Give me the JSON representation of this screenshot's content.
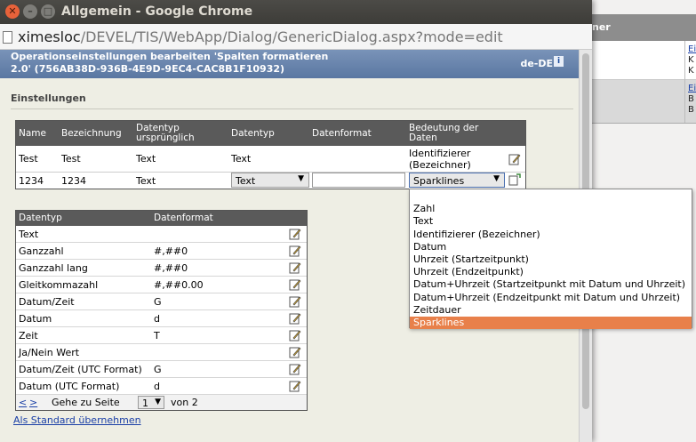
{
  "window": {
    "title": "Allgemein - Google Chrome"
  },
  "address": {
    "host": "ximesloc",
    "path": "/DEVEL/TIS/WebApp/Dialog/GenericDialog.aspx?mode=edit"
  },
  "dialog": {
    "header_line1": "Operationseinstellungen bearbeiten 'Spalten formatieren",
    "header_line2": "2.0' (756AB38D-936B-4E9D-9EC4-CAC8B1F10932)",
    "lang": "de-DE",
    "info_icon": "i"
  },
  "section": {
    "title": "Einstellungen"
  },
  "columns_table": {
    "headers": [
      "Name",
      "Bezeichnung",
      "Datentyp ursprünglich",
      "Datentyp",
      "Datenformat",
      "Bedeutung der Daten"
    ],
    "rows": [
      {
        "name": "Test",
        "label": "Test",
        "orig_type": "Text",
        "type": "Text",
        "meaning": "Identifizierer (Bezeichner)"
      },
      {
        "name": "1234",
        "label": "1234",
        "orig_type": "Text",
        "type_select": "Text",
        "format_value": "",
        "meaning_select": "Sparklines"
      }
    ]
  },
  "format_table": {
    "headers": [
      "Datentyp",
      "Datenformat"
    ],
    "rows": [
      {
        "type": "Text",
        "format": ""
      },
      {
        "type": "Ganzzahl",
        "format": "#,##0"
      },
      {
        "type": "Ganzzahl lang",
        "format": "#,##0"
      },
      {
        "type": "Gleitkommazahl",
        "format": "#,##0.00"
      },
      {
        "type": "Datum/Zeit",
        "format": "G"
      },
      {
        "type": "Datum",
        "format": "d"
      },
      {
        "type": "Zeit",
        "format": "T"
      },
      {
        "type": "Ja/Nein Wert",
        "format": ""
      },
      {
        "type": "Datum/Zeit (UTC Format)",
        "format": "G"
      },
      {
        "type": "Datum (UTC Format)",
        "format": "d"
      }
    ],
    "pager": {
      "prev": "<",
      "next": ">",
      "goto_label": "Gehe zu Seite",
      "page": "1",
      "of_label": "von 2"
    }
  },
  "default_link": "Als Standard übernehmen",
  "dropdown": {
    "options": [
      "",
      "Zahl",
      "Text",
      "Identifizierer (Bezeichner)",
      "Datum",
      "Uhrzeit (Startzeitpunkt)",
      "Uhrzeit (Endzeitpunkt)",
      "Datum+Uhrzeit (Startzeitpunkt mit Datum und Uhrzeit)",
      "Datum+Uhrzeit (Endzeitpunkt mit Datum und Uhrzeit)",
      "Zeitdauer",
      "Sparklines"
    ],
    "selected": "Sparklines"
  },
  "background": {
    "header_fragment": "ner",
    "cells": [
      "Ei",
      "K",
      "K",
      "Ei",
      "B",
      "B"
    ]
  },
  "colors": {
    "accent": "#e8804a",
    "header_bg": "#5a5a5a",
    "dialog_header": "#5a77a2"
  }
}
